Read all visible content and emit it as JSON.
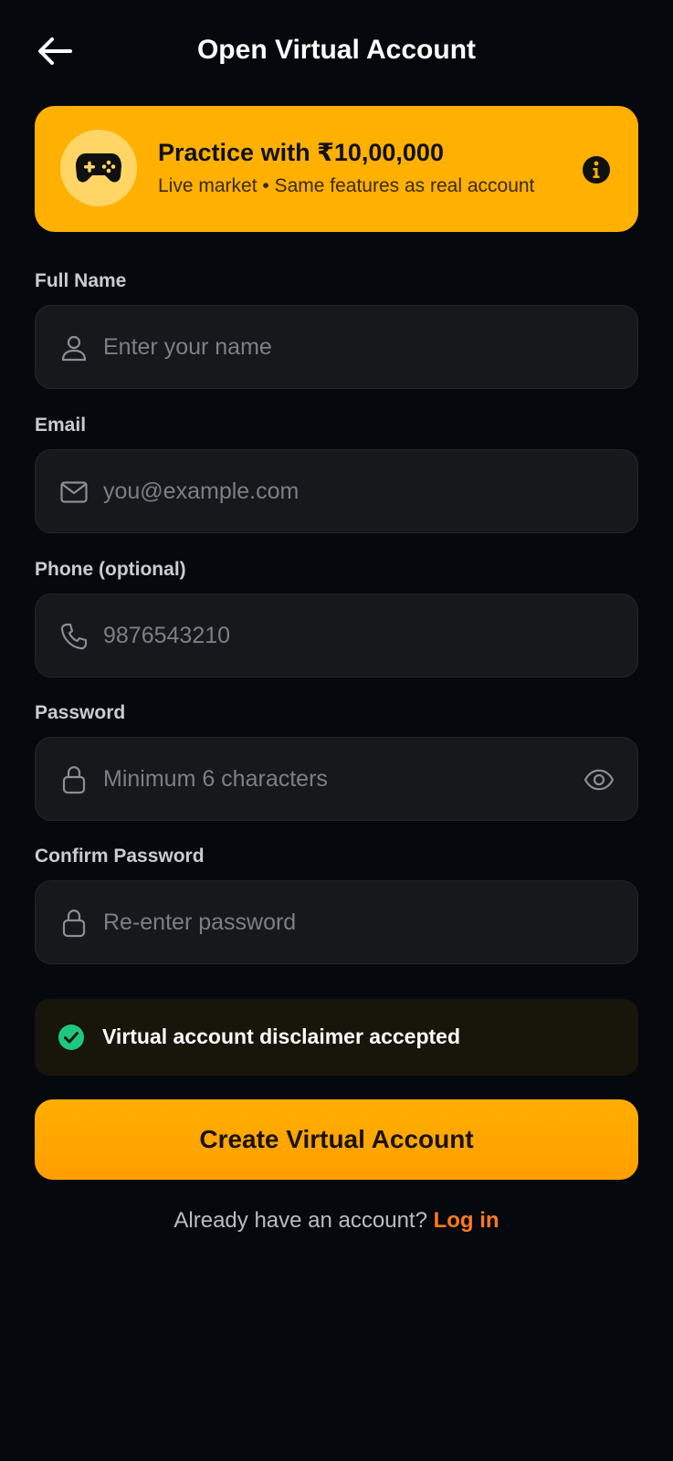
{
  "header": {
    "title": "Open Virtual Account",
    "back_icon": "arrow-left-icon"
  },
  "banner": {
    "title": "Practice with ₹10,00,000",
    "subtitle": "Live market • Same features as real account",
    "icon": "gamepad-icon",
    "info_icon": "info-icon"
  },
  "form": {
    "full_name": {
      "label": "Full Name",
      "placeholder": "Enter your name",
      "value": ""
    },
    "email": {
      "label": "Email",
      "placeholder": "you@example.com",
      "value": ""
    },
    "phone": {
      "label": "Phone (optional)",
      "placeholder": "9876543210",
      "value": ""
    },
    "password": {
      "label": "Password",
      "placeholder": "Minimum 6 characters",
      "value": ""
    },
    "confirm_password": {
      "label": "Confirm Password",
      "placeholder": "Re-enter password",
      "value": ""
    }
  },
  "disclaimer": {
    "text": "Virtual account disclaimer accepted",
    "checked": true
  },
  "actions": {
    "create_label": "Create Virtual Account",
    "login_prompt": "Already have an account?",
    "login_link": "Log in"
  },
  "colors": {
    "background": "#05080d",
    "accent": "#ffb000",
    "button": "#ffa200",
    "link": "#ff7a1a",
    "success": "#1fc77e",
    "field_bg": "#17181b"
  }
}
